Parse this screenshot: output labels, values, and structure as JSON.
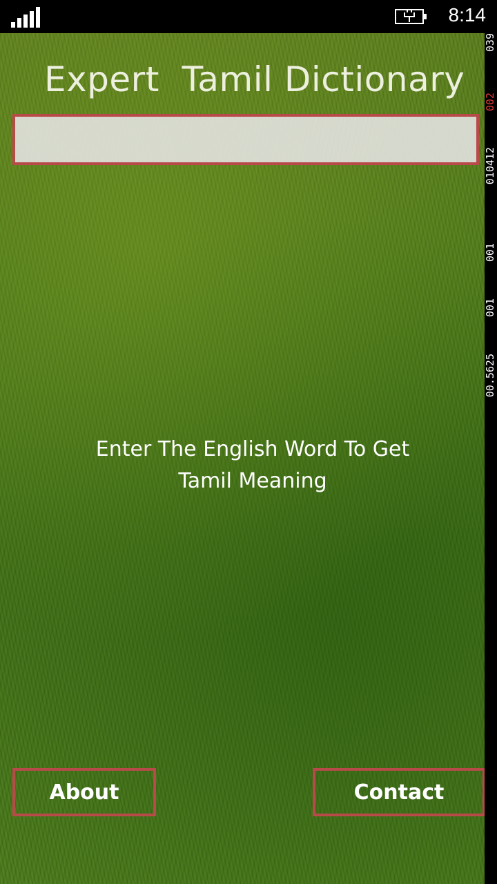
{
  "status_bar": {
    "time": "8:14",
    "signal_icon": "signal-strength-icon",
    "battery_icon": "battery-charging-icon"
  },
  "app": {
    "title": "Expert  Tamil Dictionary",
    "search": {
      "value": "",
      "placeholder": ""
    },
    "instructions": "Enter The English Word To Get\nTamil  Meaning",
    "buttons": {
      "about": "About",
      "contact": "Contact"
    }
  },
  "debug_counters": [
    {
      "text": "039",
      "color": "white"
    },
    {
      "text": "002",
      "color": "red"
    },
    {
      "text": "010412",
      "color": "white"
    },
    {
      "text": "001",
      "color": "white"
    },
    {
      "text": "001",
      "color": "white"
    },
    {
      "text": "00.5625",
      "color": "white"
    }
  ],
  "colors": {
    "accent_border": "#b94a4a",
    "title_text": "#eef0df",
    "grass_green": "#4c7a18"
  }
}
